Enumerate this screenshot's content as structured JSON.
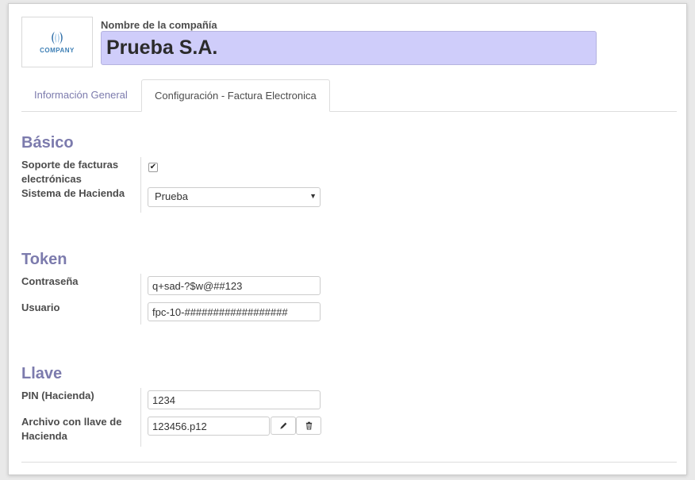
{
  "company": {
    "logo_text": "COMPANY",
    "name_label": "Nombre de la compañía",
    "name_value": "Prueba S.A."
  },
  "tabs": [
    {
      "label": "Información General",
      "active": false
    },
    {
      "label": "Configuración - Factura Electronica",
      "active": true
    }
  ],
  "sections": {
    "basico": {
      "title": "Básico",
      "soporte_label": "Soporte de facturas electrónicas",
      "soporte_checked": true,
      "sistema_label": "Sistema de Hacienda",
      "sistema_value": "Prueba"
    },
    "token": {
      "title": "Token",
      "password_label": "Contraseña",
      "password_value": "q+sad-?$w@##123",
      "user_label": "Usuario",
      "user_value": "fpc-10-##################"
    },
    "llave": {
      "title": "Llave",
      "pin_label": "PIN (Hacienda)",
      "pin_value": "1234",
      "file_label": "Archivo con llave de Hacienda",
      "file_value": "123456.p12"
    }
  },
  "icons": {
    "checkmark": "check-icon",
    "caret": "caret-down-icon",
    "edit": "pencil-icon",
    "delete": "trash-icon"
  },
  "colors": {
    "accent": "#7c7bad",
    "company_input_bg": "#cfcdfa"
  }
}
